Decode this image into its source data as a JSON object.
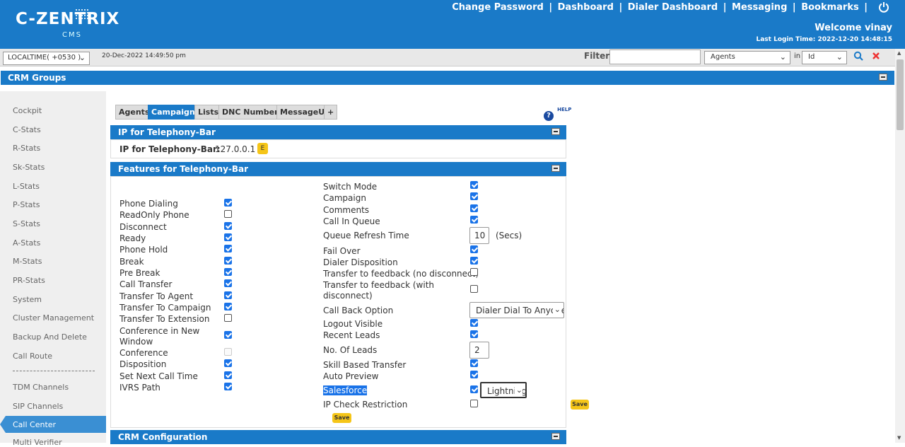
{
  "header": {
    "logo_main": "C-ZENTRIX",
    "logo_sub": "CMS",
    "links": [
      "Change Password",
      "Dashboard",
      "Dialer Dashboard",
      "Messaging",
      "Bookmarks"
    ],
    "link_separator": "|",
    "power_icon": "power-icon",
    "welcome": "Welcome vinay",
    "last_login": "Last Login Time: 2022-12-20 14:48:15"
  },
  "filterbar": {
    "timezone": "LOCALTIME( +0530 )",
    "datetime": "20-Dec-2022 14:49:50 pm",
    "filter_label": "Filter",
    "filter_value": "",
    "filter_type": "Agents",
    "in_label": "in",
    "filter_field": "Id"
  },
  "crm_groups": {
    "title": "CRM Groups"
  },
  "sidebar": {
    "items": [
      "Cockpit",
      "C-Stats",
      "R-Stats",
      "Sk-Stats",
      "L-Stats",
      "P-Stats",
      "S-Stats",
      "A-Stats",
      "M-Stats",
      "PR-Stats",
      "System",
      "Cluster Management",
      "Backup And Delete",
      "Call Route"
    ],
    "items_after_divider": [
      "TDM Channels",
      "SIP Channels"
    ],
    "active": "Call Center",
    "partial": "Multi Verifier"
  },
  "tabs": [
    {
      "label": "Agents",
      "active": false
    },
    {
      "label": "Campaigns",
      "active": true
    },
    {
      "label": "Lists",
      "active": false
    },
    {
      "label": "DNC Numbers",
      "active": false
    },
    {
      "label": "MessageUI",
      "active": false
    },
    {
      "label": "+",
      "active": false
    }
  ],
  "help": {
    "icon": "?",
    "label": "HELP"
  },
  "ip_panel": {
    "title": "IP for Telephony-Bar",
    "label": "IP for Telephony-Bar:",
    "value": "127.0.0.1",
    "edit": "E"
  },
  "features_panel": {
    "title": "Features for Telephony-Bar",
    "left": [
      {
        "label": "Phone Dialing",
        "checked": true
      },
      {
        "label": "ReadOnly Phone",
        "checked": false
      },
      {
        "label": "Disconnect",
        "checked": true
      },
      {
        "label": "Ready",
        "checked": true
      },
      {
        "label": "Phone Hold",
        "checked": true
      },
      {
        "label": "Break",
        "checked": true
      },
      {
        "label": "Pre Break",
        "checked": true
      },
      {
        "label": "Call Transfer",
        "checked": true
      },
      {
        "label": "Transfer To Agent",
        "checked": true
      },
      {
        "label": "Transfer To Campaign",
        "checked": true
      },
      {
        "label": "Transfer To Extension",
        "checked": false
      },
      {
        "label": "Conference in New Window",
        "checked": true
      },
      {
        "label": "Conference",
        "checked": false,
        "disabled": true
      },
      {
        "label": "Disposition",
        "checked": true
      },
      {
        "label": "Set Next Call Time",
        "checked": true
      },
      {
        "label": "IVRS Path",
        "checked": true
      }
    ],
    "right": [
      {
        "label": "Switch Mode",
        "checked": true
      },
      {
        "label": "Campaign",
        "checked": true
      },
      {
        "label": "Comments",
        "checked": true
      },
      {
        "label": "Call In Queue",
        "checked": true
      },
      {
        "label": "Queue Refresh Time",
        "value": "10",
        "unit": "(Secs)"
      },
      {
        "label": "Fail Over",
        "checked": true
      },
      {
        "label": "Dialer Disposition",
        "checked": true
      },
      {
        "label": "Transfer to feedback (no disconnect)",
        "checked": false
      },
      {
        "label": "Transfer to feedback (with disconnect)",
        "checked": false
      },
      {
        "label": "Call Back Option",
        "select": "Dialer Dial To Anyone"
      },
      {
        "label": "Logout Visible",
        "checked": true
      },
      {
        "label": "Recent Leads",
        "checked": true
      },
      {
        "label": "No. Of Leads",
        "value": "2"
      },
      {
        "label": "Skill Based Transfer",
        "checked": true
      },
      {
        "label": "Auto Preview",
        "checked": true
      },
      {
        "label": "Salesforce",
        "checked": true,
        "select": "Lightning"
      },
      {
        "label": "IP Check Restriction",
        "checked": false
      }
    ],
    "save_label": "Save",
    "save_label_side": "Save"
  },
  "crm_config": {
    "title": "CRM Configuration"
  }
}
